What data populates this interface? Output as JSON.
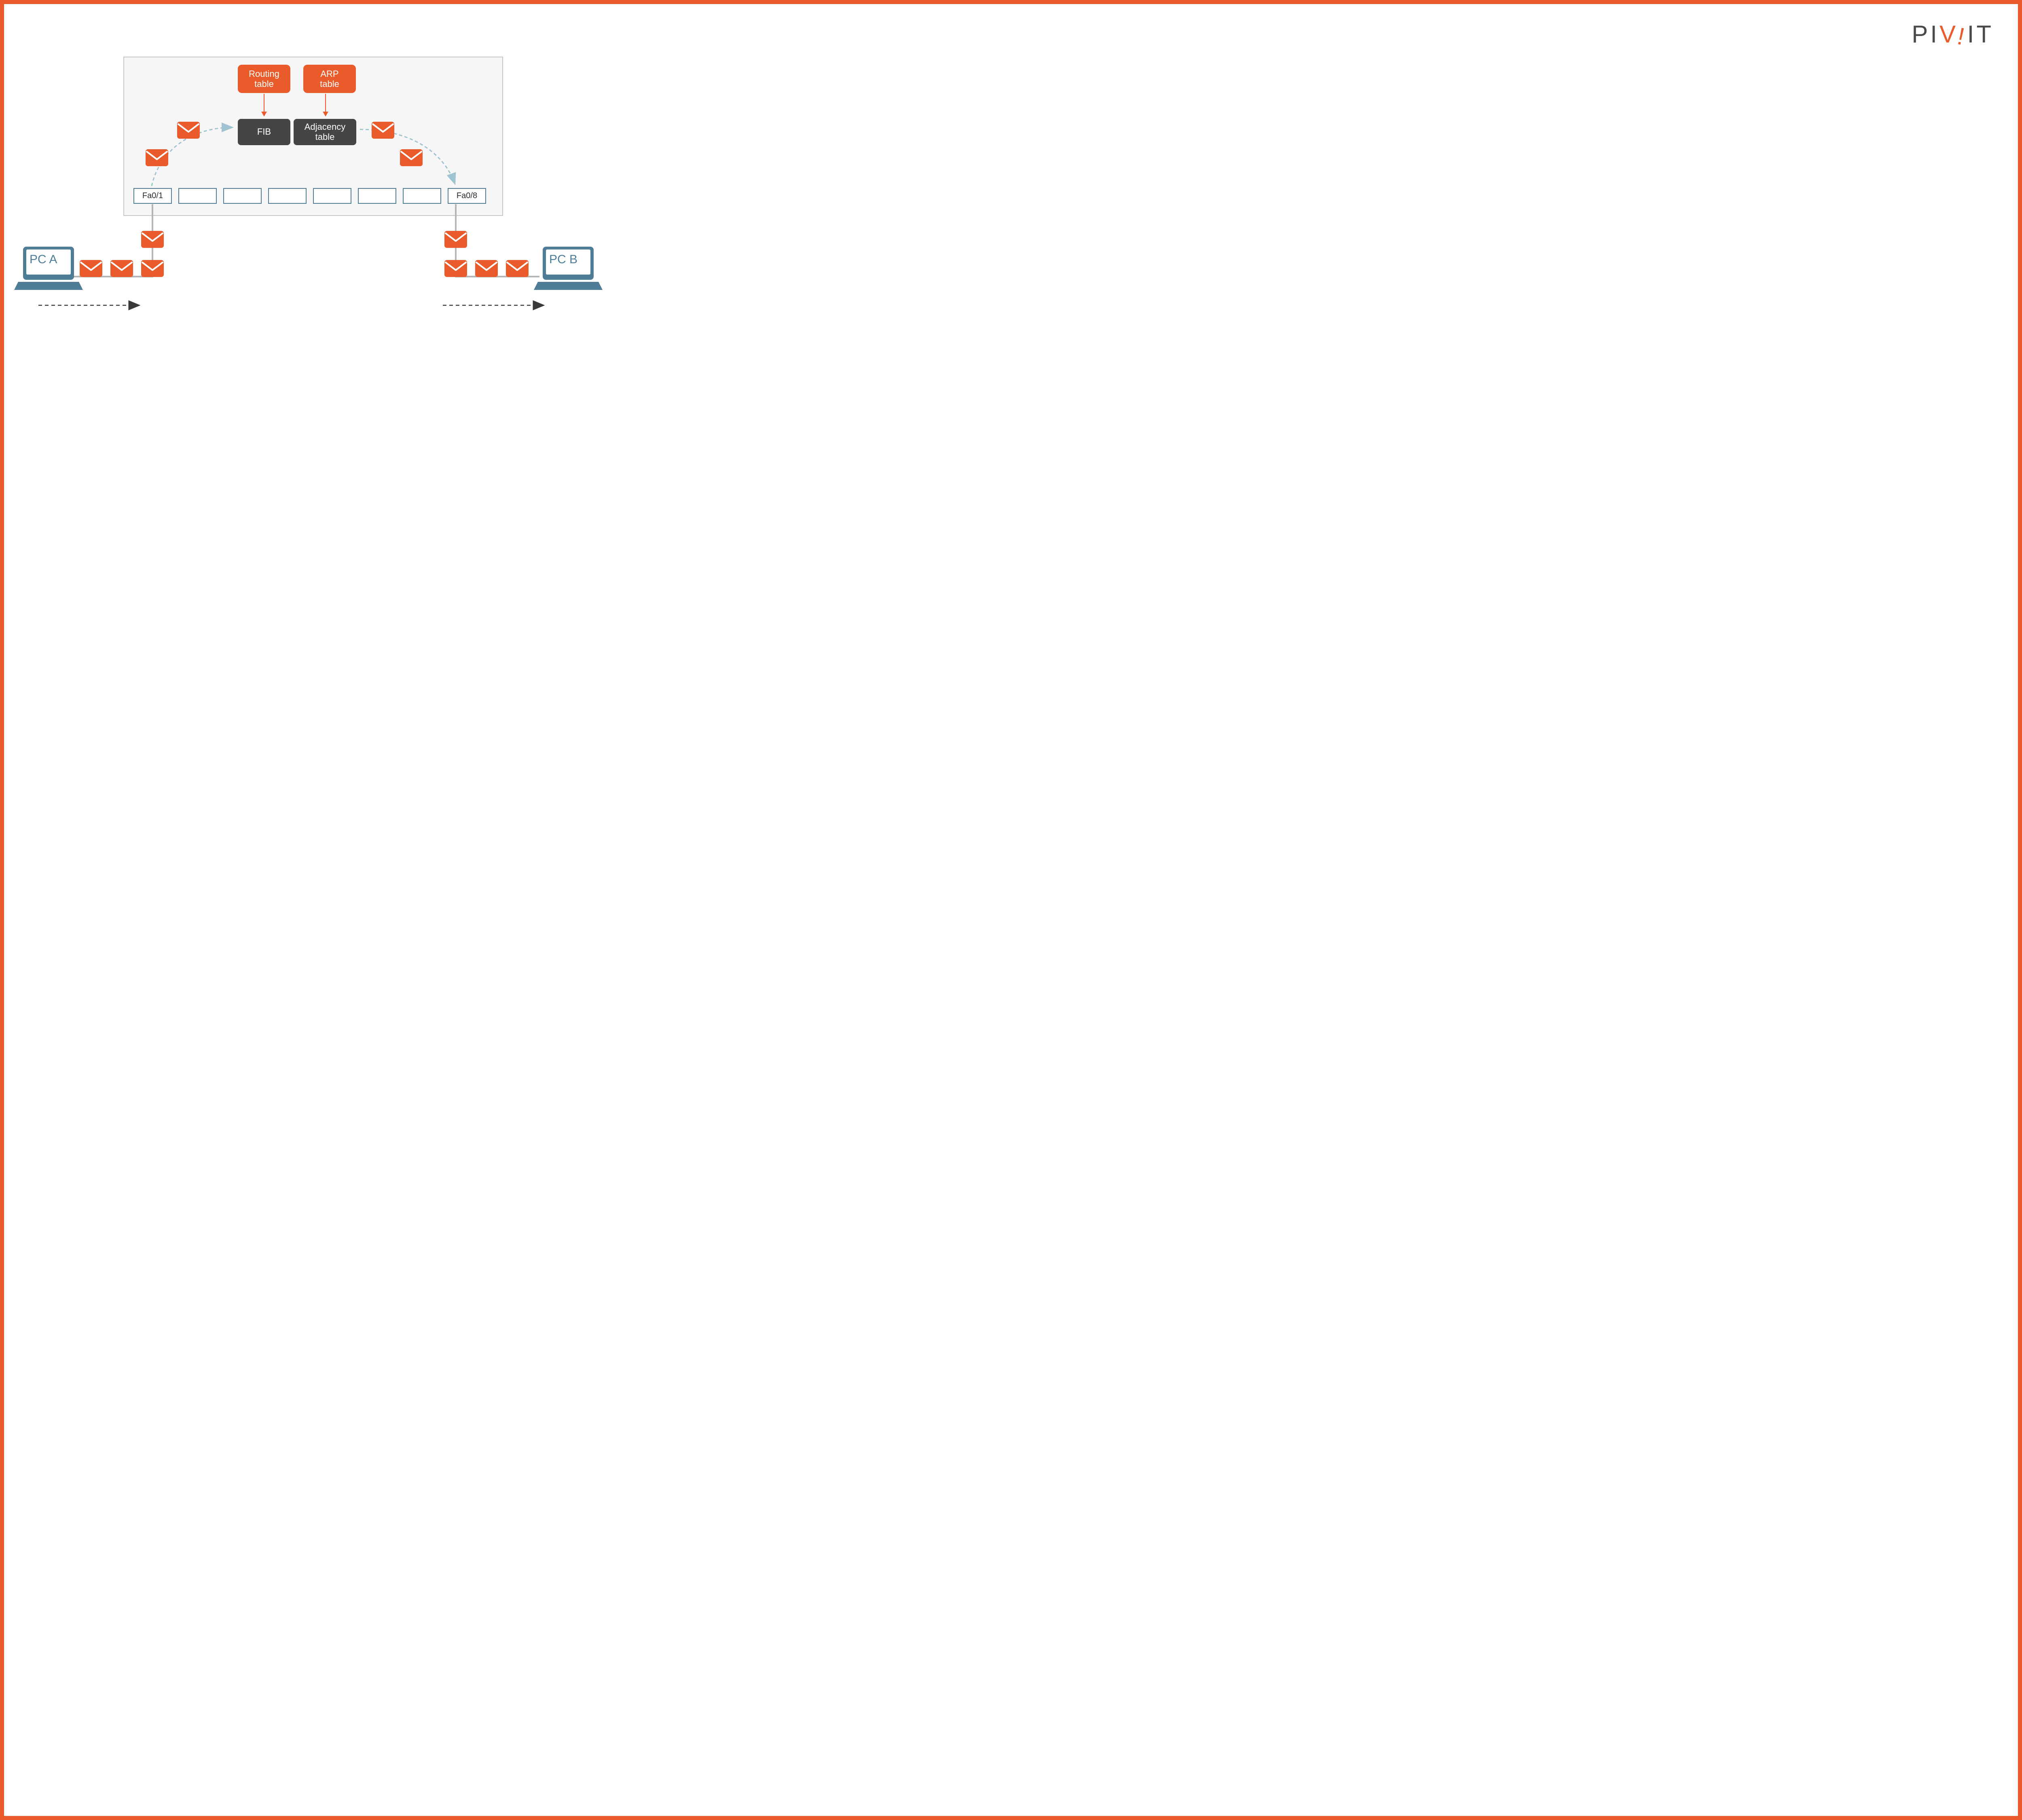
{
  "logo": {
    "p": "P",
    "i1": "I",
    "v": "V",
    "bang": "!",
    "i2": "I",
    "t": "T"
  },
  "boxes": {
    "routing": "Routing\ntable",
    "arp": "ARP\ntable",
    "fib": "FIB",
    "adj": "Adjacency\ntable"
  },
  "ports": {
    "left": "Fa0/1",
    "right": "Fa0/8"
  },
  "hosts": {
    "a": "PC A",
    "b": "PC B"
  },
  "colors": {
    "accent": "#ea5b2b",
    "dark": "#454548",
    "steel": "#4f7d97",
    "teal": "#9fc4cf"
  },
  "icons": {
    "envelope": "envelope-icon",
    "laptop": "laptop-icon"
  }
}
